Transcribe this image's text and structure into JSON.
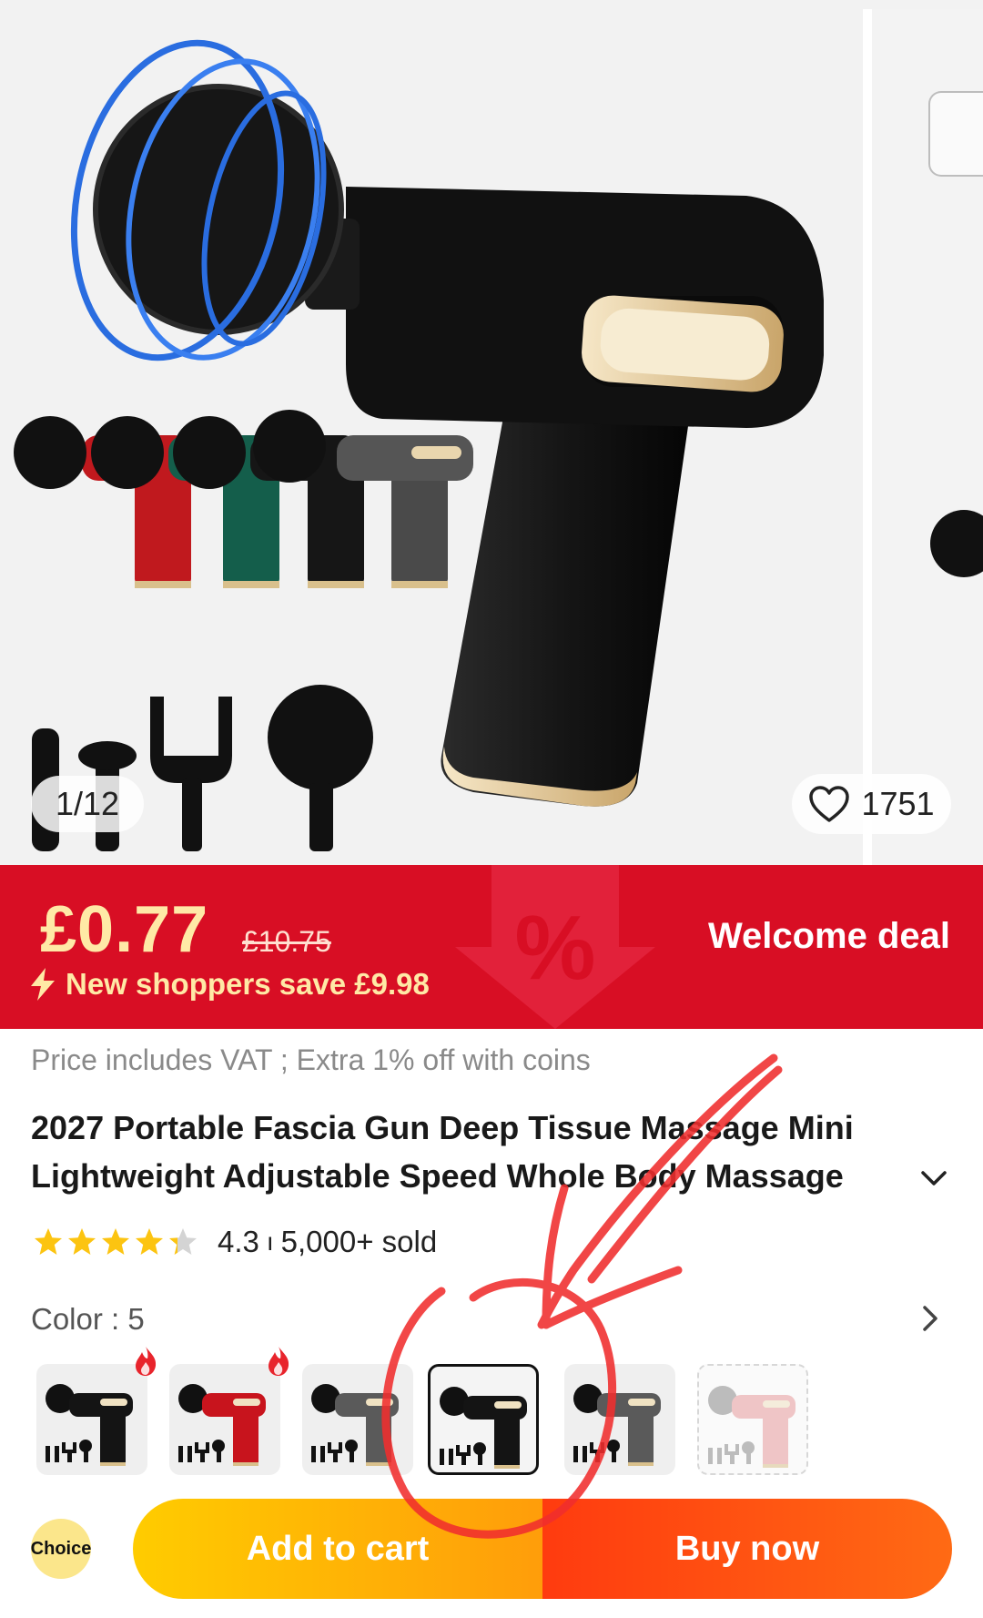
{
  "gallery": {
    "counter": "1/12",
    "likes": "1751"
  },
  "deal": {
    "price": "£0.77",
    "original_price": "£10.75",
    "save_text": "New shoppers save  £9.98",
    "label": "Welcome deal",
    "colors": {
      "banner": "#d80e24",
      "price": "#ffe9a6"
    }
  },
  "product": {
    "vat_note": "Price includes VAT ; Extra 1% off with coins",
    "title": "2027 Portable Fascia Gun Deep Tissue Massage Mini Lightweight Adjustable Speed Whole Body Massage",
    "rating": "4.3",
    "rating_stars": 4.3,
    "separator": "ı",
    "sold": "5,000+ sold"
  },
  "color": {
    "label": "Color : 5",
    "swatches": [
      {
        "name": "Black",
        "hot": true,
        "selected": false
      },
      {
        "name": "Red",
        "hot": true,
        "selected": false
      },
      {
        "name": "Grey",
        "hot": false,
        "selected": false
      },
      {
        "name": "Black",
        "hot": false,
        "selected": true
      },
      {
        "name": "Grey",
        "hot": false,
        "selected": false
      },
      {
        "name": "Pink",
        "hot": false,
        "selected": false,
        "unavailable": true
      }
    ]
  },
  "actions": {
    "choice_badge": "Choice",
    "add_to_cart": "Add to cart",
    "buy_now": "Buy now",
    "colors": {
      "add_to_cart": "#ffb000",
      "buy_now": "#ff4a10"
    }
  },
  "icons": [
    "heart-icon",
    "lightning-icon",
    "chevron-down-icon",
    "chevron-right-icon",
    "star-icon",
    "fire-icon"
  ]
}
